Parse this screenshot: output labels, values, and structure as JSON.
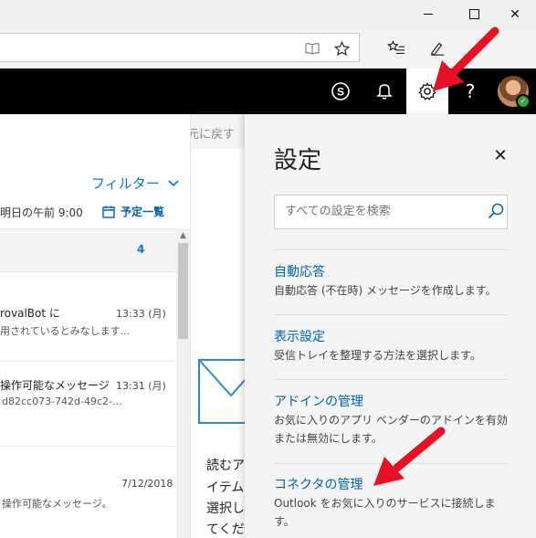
{
  "window": {
    "minimize_glyph": "—",
    "maximize_glyph": "☐",
    "close_glyph": "✕"
  },
  "browser": {
    "icons": [
      "reading-view-icon",
      "favorite-star-icon",
      "favorites-hub-icon",
      "pen-icon"
    ]
  },
  "header": {
    "icons": [
      "skype-icon",
      "bell-icon",
      "gear-icon",
      "help-icon",
      "avatar"
    ],
    "help_glyph": "?",
    "skype_glyph": "S"
  },
  "mail": {
    "undo_label": "元に戻す",
    "filter_label": "フィルター",
    "agenda_time": "明日の午前 9:00",
    "agenda_link": "予定一覧",
    "group_count": "4",
    "messages": [
      {
        "sender": "rovalBot に",
        "time": "13:33 (月)",
        "preview": "用されているとみなします..."
      },
      {
        "sender": "操作可能なメッセージ",
        "time": "13:31 (月)",
        "preview": "d82cc073-742d-49c2-..."
      },
      {
        "sender": "",
        "time": "7/12/2018",
        "preview": "操作可能なメッセージ。"
      }
    ]
  },
  "reading": {
    "lines": [
      "読むア",
      "イテムを",
      "選択し",
      "てくださ"
    ]
  },
  "settings": {
    "title": "設定",
    "close_glyph": "✕",
    "search_placeholder": "すべての設定を検索",
    "sections": [
      {
        "title": "自動応答",
        "desc": "自動応答 (不在時) メッセージを作成します。"
      },
      {
        "title": "表示設定",
        "desc": "受信トレイを整理する方法を選択します。"
      },
      {
        "title": "アドインの管理",
        "desc": "お気に入りのアプリ ベンダーのアドインを有効または無効にします。"
      },
      {
        "title": "コネクタの管理",
        "desc": "Outlook をお気に入りのサービスに接続します。"
      }
    ]
  },
  "colors": {
    "accent": "#0078d4",
    "link": "#0063b1",
    "arrow": "#e81123",
    "header_bg": "#000000"
  }
}
